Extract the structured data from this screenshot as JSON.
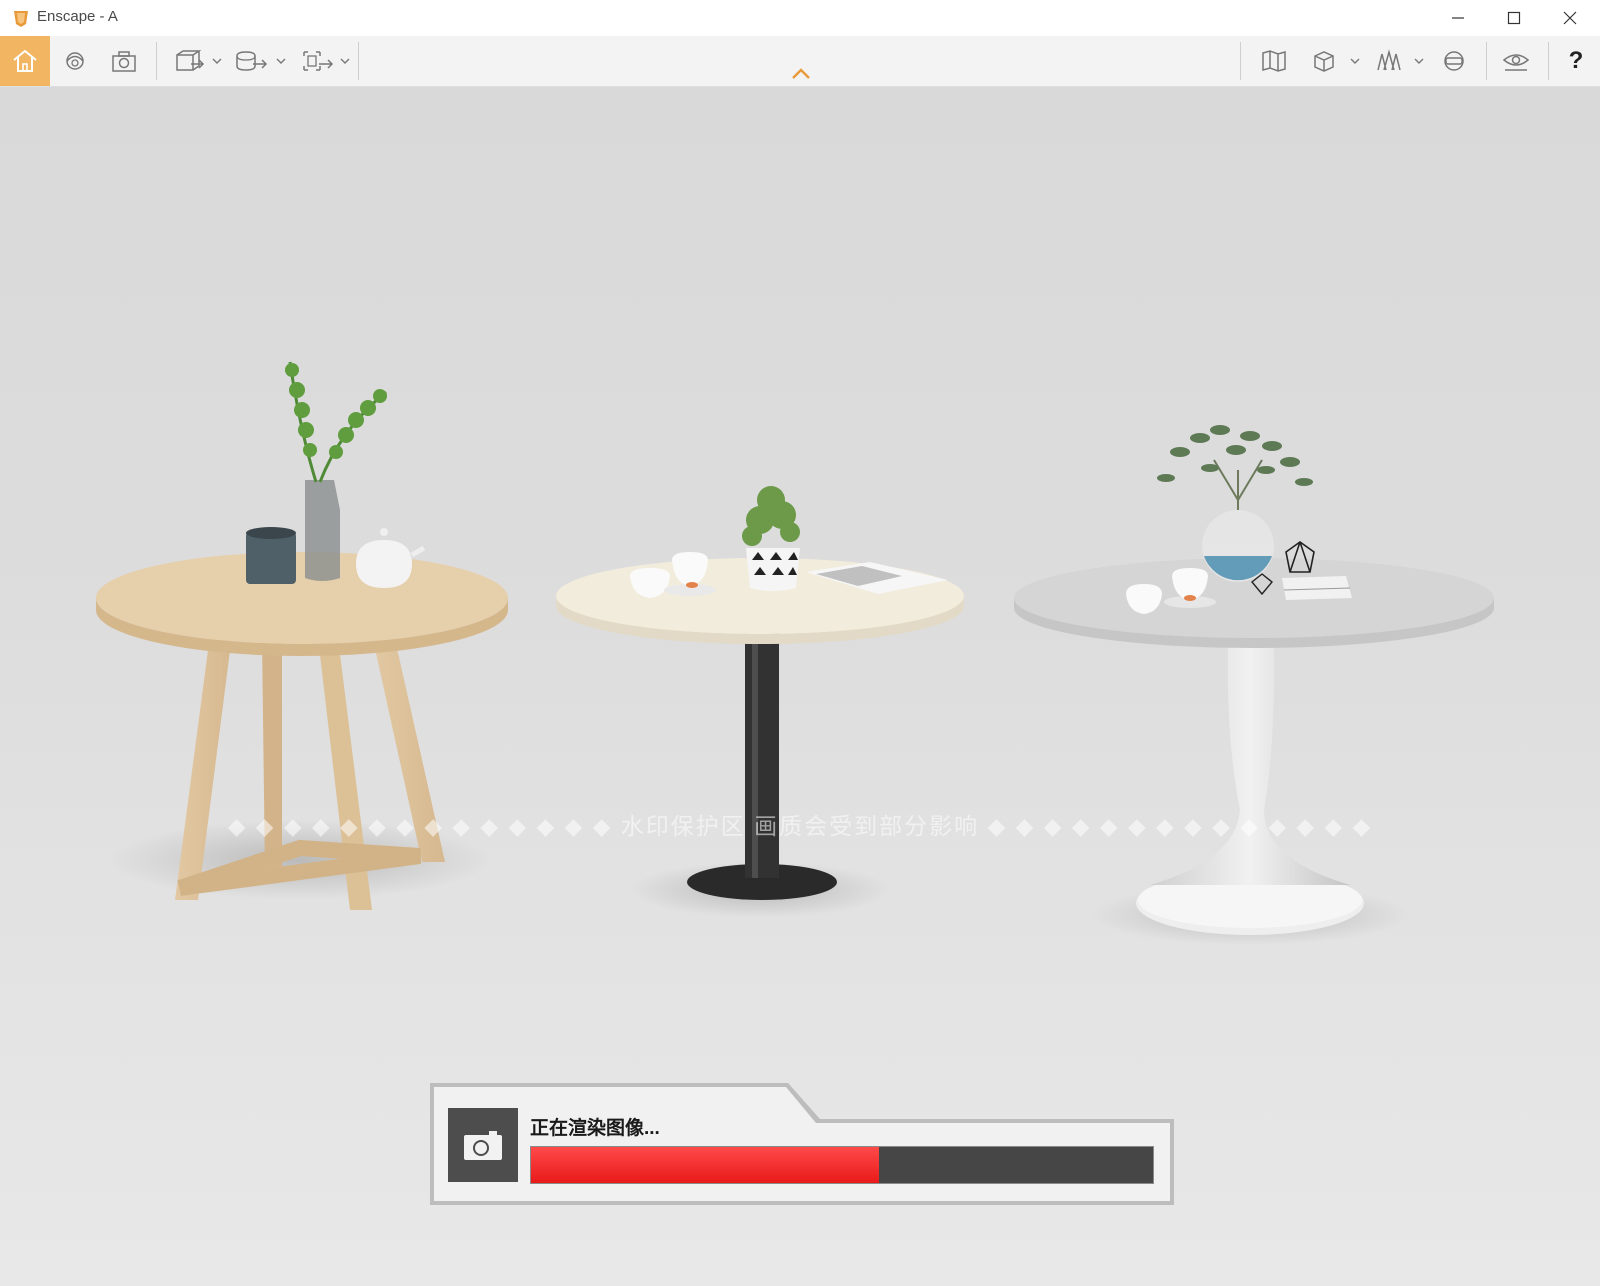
{
  "window": {
    "title": "Enscape - A"
  },
  "toolbar": {
    "left_icons": [
      "home-icon",
      "orbit-view-icon",
      "screenshot-icon",
      "export-view-icon",
      "video-export-icon",
      "panorama-export-icon"
    ],
    "right_icons": [
      "map-icon",
      "cube-view-icon",
      "asset-library-icon",
      "vr-headset-icon",
      "visibility-icon"
    ],
    "help_label": "?"
  },
  "colors": {
    "accent": "#f2b562",
    "progress_fill": "#e81a1a",
    "progress_track": "#464646"
  },
  "viewport": {
    "watermark": "◆ ◆ ◆ ◆ ◆ ◆ ◆ ◆ ◆ ◆ ◆ ◆ ◆ ◆ 水印保护区  画质会受到部分影响 ◆ ◆ ◆ ◆ ◆ ◆ ◆ ◆ ◆ ◆ ◆ ◆ ◆ ◆"
  },
  "render": {
    "status": "正在渲染图像...",
    "progress_fraction": 0.56
  }
}
